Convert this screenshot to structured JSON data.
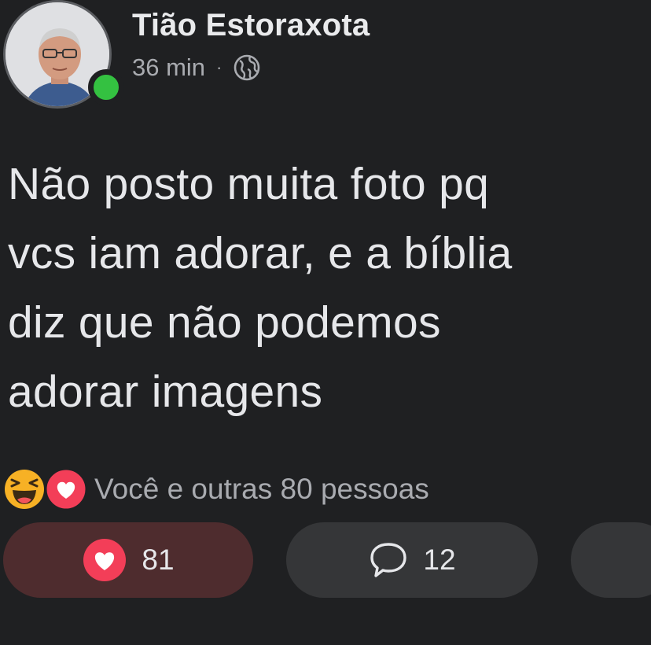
{
  "post": {
    "author_name": "Tião Estoraxota",
    "time": "36 min",
    "separator": "·",
    "privacy_icon": "globe-icon",
    "online_status_color": "#34c141",
    "text": "Não posto muita foto pq\nvcs iam adorar, e a bíblia\ndiz que não podemos\nadorar imagens"
  },
  "reactions": {
    "icons": [
      "haha-icon",
      "love-icon"
    ],
    "summary": "Você e outras 80 pessoas"
  },
  "actions": {
    "like_count": "81",
    "comment_count": "12",
    "like_icon": "love-icon",
    "comment_icon": "comment-bubble-icon"
  },
  "colors": {
    "background": "#1f2022",
    "love_red": "#f33e58",
    "haha_yellow": "#f7b125",
    "like_pill": "#4e2c2e",
    "neutral_pill": "#353638"
  }
}
